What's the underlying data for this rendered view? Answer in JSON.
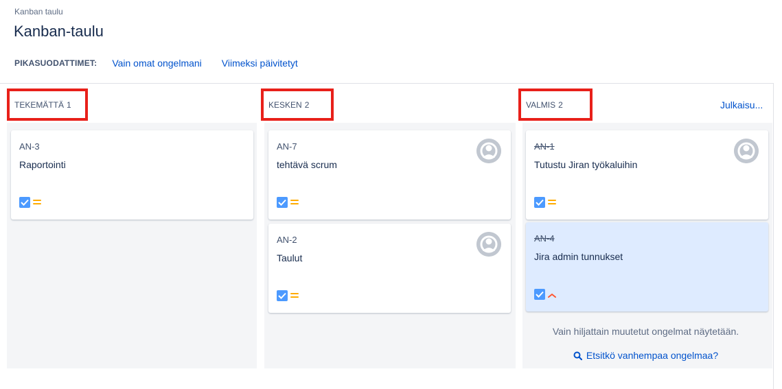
{
  "breadcrumb": "Kanban taulu",
  "title": "Kanban-taulu",
  "quickfilters": {
    "label": "PIKASUODATTIMET:",
    "links": [
      "Vain omat ongelmani",
      "Viimeksi päivitetyt"
    ]
  },
  "columns": [
    {
      "name": "TEKEMÄTTÄ",
      "count": "1",
      "cards": [
        {
          "key": "AN-3",
          "summary": "Raportointi",
          "priority": "medium",
          "assignee": false,
          "done": false
        }
      ]
    },
    {
      "name": "KESKEN",
      "count": "2",
      "cards": [
        {
          "key": "AN-7",
          "summary": "tehtävä scrum",
          "priority": "medium",
          "assignee": true,
          "done": false
        },
        {
          "key": "AN-2",
          "summary": "Taulut",
          "priority": "medium",
          "assignee": true,
          "done": false
        }
      ]
    },
    {
      "name": "VALMIS",
      "count": "2",
      "release_label": "Julkaisu...",
      "cards": [
        {
          "key": "AN-1",
          "summary": "Tutustu Jiran työkaluihin",
          "priority": "medium",
          "assignee": true,
          "done": true
        },
        {
          "key": "AN-4",
          "summary": "Jira admin tunnukset",
          "priority": "high",
          "assignee": false,
          "done": true,
          "selected": true
        }
      ],
      "footer_note": "Vain hiljattain muutetut ongelmat näytetään.",
      "footer_link": "Etsitkö vanhempaa ongelmaa?"
    }
  ],
  "icons": {
    "issue_type": "checkbox-task-icon",
    "priority_medium": "priority-medium-icon",
    "priority_high": "priority-high-icon",
    "avatar": "default-avatar-icon",
    "search": "search-icon"
  },
  "colors": {
    "link": "#0052cc",
    "highlight_border": "#e8201a",
    "column_bg": "#f4f5f7",
    "selected_card": "#deebff",
    "task_icon": "#4c9aff",
    "priority_medium": "#ffab00",
    "priority_high": "#ff5630"
  }
}
